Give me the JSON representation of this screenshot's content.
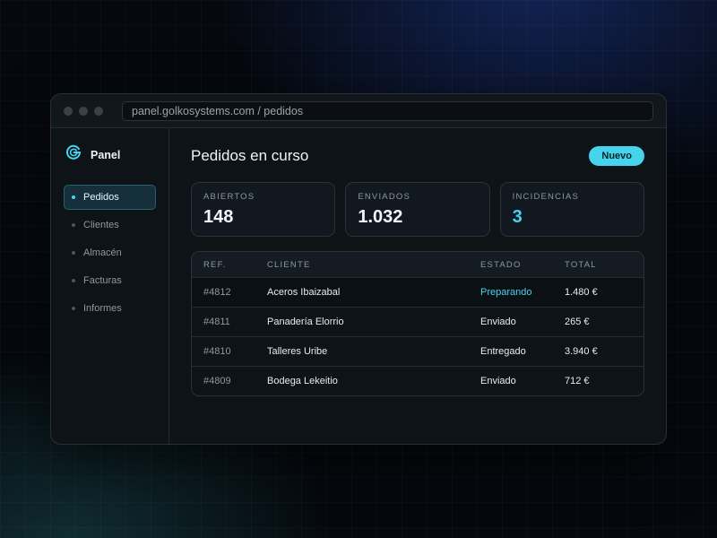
{
  "browser": {
    "url": "panel.golkosystems.com / pedidos"
  },
  "sidebar": {
    "brand": "Panel",
    "items": [
      {
        "label": "Pedidos",
        "active": true
      },
      {
        "label": "Clientes",
        "active": false
      },
      {
        "label": "Almacén",
        "active": false
      },
      {
        "label": "Facturas",
        "active": false
      },
      {
        "label": "Informes",
        "active": false
      }
    ]
  },
  "main": {
    "title": "Pedidos en curso",
    "new_button": "Nuevo",
    "stats": [
      {
        "label": "ABIERTOS",
        "value": "148"
      },
      {
        "label": "ENVIADOS",
        "value": "1.032"
      },
      {
        "label": "INCIDENCIAS",
        "value": "3"
      }
    ],
    "table": {
      "columns": [
        "REF.",
        "CLIENTE",
        "ESTADO",
        "TOTAL"
      ],
      "rows": [
        {
          "ref": "#4812",
          "client": "Aceros Ibaizabal",
          "status": "Preparando",
          "total": "1.480 €"
        },
        {
          "ref": "#4811",
          "client": "Panadería Elorrio",
          "status": "Enviado",
          "total": "265 €"
        },
        {
          "ref": "#4810",
          "client": "Talleres Uribe",
          "status": "Entregado",
          "total": "3.940 €"
        },
        {
          "ref": "#4809",
          "client": "Bodega Lekeitio",
          "status": "Enviado",
          "total": "712 €"
        }
      ]
    }
  },
  "colors": {
    "accent": "#47d3ec",
    "background": "#0e1318"
  },
  "icons": {
    "brand": "brand-logo-icon"
  }
}
